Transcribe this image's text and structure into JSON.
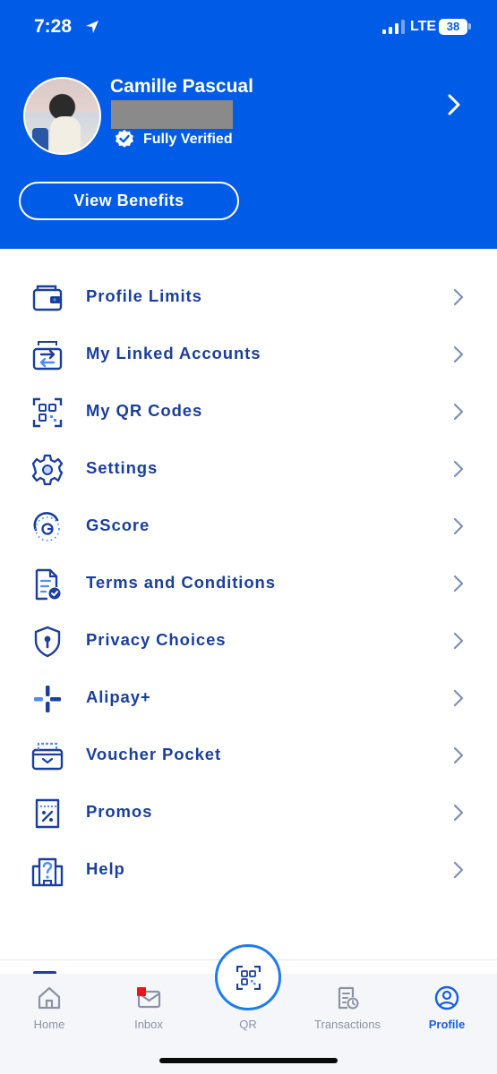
{
  "status_bar": {
    "time": "7:28",
    "network": "LTE",
    "battery": "38"
  },
  "profile": {
    "name": "Camille Pascual",
    "verification": "Fully Verified",
    "benefits_button": "View Benefits"
  },
  "menu": {
    "items": [
      {
        "label": "Profile Limits",
        "icon": "wallet-icon"
      },
      {
        "label": "My Linked Accounts",
        "icon": "linked-accounts-icon"
      },
      {
        "label": "My QR Codes",
        "icon": "qr-code-icon"
      },
      {
        "label": "Settings",
        "icon": "gear-icon"
      },
      {
        "label": "GScore",
        "icon": "gscore-icon"
      },
      {
        "label": "Terms and Conditions",
        "icon": "document-check-icon"
      },
      {
        "label": "Privacy Choices",
        "icon": "shield-lock-icon"
      },
      {
        "label": "Alipay+",
        "icon": "alipay-plus-icon"
      },
      {
        "label": "Voucher Pocket",
        "icon": "voucher-box-icon"
      },
      {
        "label": "Promos",
        "icon": "promo-ticket-icon"
      },
      {
        "label": "Help",
        "icon": "help-building-icon"
      }
    ]
  },
  "tabbar": {
    "tabs": [
      {
        "label": "Home",
        "icon": "home-icon"
      },
      {
        "label": "Inbox",
        "icon": "mail-icon"
      },
      {
        "label": "QR",
        "icon": "qr-scan-icon"
      },
      {
        "label": "Transactions",
        "icon": "receipt-icon"
      },
      {
        "label": "Profile",
        "icon": "user-circle-icon"
      }
    ],
    "active": "Profile"
  },
  "colors": {
    "brand_blue": "#005ce6",
    "menu_text": "#1a3f9c",
    "active_tab": "#1c5fd6",
    "inactive_tab": "#8a93a6",
    "notification_dot": "#e8161e"
  }
}
